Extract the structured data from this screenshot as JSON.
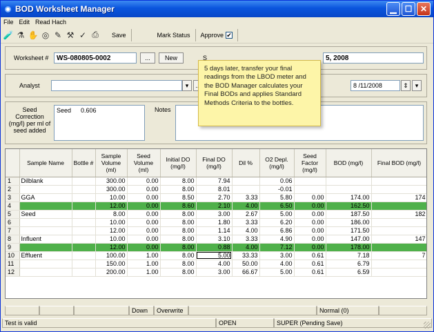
{
  "window": {
    "title": "BOD Worksheet Manager"
  },
  "menu": [
    "File",
    "Edit",
    "Read Hach"
  ],
  "toolbar": {
    "save": "Save",
    "mark_status": "Mark Status",
    "approve": "Approve",
    "approve_checked": "✔"
  },
  "header": {
    "worksheet_label": "Worksheet #",
    "worksheet_value": "WS-080805-0002",
    "browse_label": "...",
    "new_label": "New",
    "s_label": "S",
    "date_fragment": "5, 2008",
    "analyst_label": "Analyst",
    "analyst_value": "",
    "dots_label": "...",
    "date_value": "8 /11/2008"
  },
  "seed": {
    "correction_label": "Seed Correction (mg/l) per ml of seed added",
    "seed_name": "Seed",
    "seed_value": "0.606",
    "notes_label": "Notes"
  },
  "tooltip": "5 days later, transfer your final readings from the LBOD meter and the BOD Manager calculates your Final BODs and applies Standard Methods Criteria to the bottles.",
  "table": {
    "columns": [
      "",
      "Sample Name",
      "Bottle #",
      "Sample Volume (ml)",
      "Seed Volume (ml)",
      "Initial DO (mg/l)",
      "Final DO (mg/l)",
      "Dil %",
      "O2 Depl. (mg/l)",
      "Seed Factor (mg/l)",
      "BOD (mg/l)",
      "Final BOD (mg/l)"
    ],
    "rows": [
      [
        "1",
        "Dilblank",
        "",
        "300.00",
        "0.00",
        "8.00",
        "7.94",
        "",
        "0.06",
        "",
        "",
        ""
      ],
      [
        "2",
        "",
        "",
        "300.00",
        "0.00",
        "8.00",
        "8.01",
        "",
        "-0.01",
        "",
        "",
        ""
      ],
      [
        "3",
        "GGA",
        "",
        "10.00",
        "0.00",
        "8.50",
        "2.70",
        "3.33",
        "5.80",
        "0.00",
        "174.00",
        "174"
      ],
      [
        "4",
        "",
        "",
        "12.00",
        "0.00",
        "8.60",
        "2.10",
        "4.00",
        "6.50",
        "0.00",
        "162.50",
        ""
      ],
      [
        "5",
        "Seed",
        "",
        "8.00",
        "0.00",
        "8.00",
        "3.00",
        "2.67",
        "5.00",
        "0.00",
        "187.50",
        "182"
      ],
      [
        "6",
        "",
        "",
        "10.00",
        "0.00",
        "8.00",
        "1.80",
        "3.33",
        "6.20",
        "0.00",
        "186.00",
        ""
      ],
      [
        "7",
        "",
        "",
        "12.00",
        "0.00",
        "8.00",
        "1.14",
        "4.00",
        "6.86",
        "0.00",
        "171.50",
        ""
      ],
      [
        "8",
        "Influent",
        "",
        "10.00",
        "0.00",
        "8.00",
        "3.10",
        "3.33",
        "4.90",
        "0.00",
        "147.00",
        "147"
      ],
      [
        "9",
        "",
        "",
        "12.00",
        "0.00",
        "8.00",
        "0.88",
        "4.00",
        "7.12",
        "0.00",
        "178.00",
        ""
      ],
      [
        "10",
        "Effluent",
        "",
        "100.00",
        "1.00",
        "8.00",
        "5.00",
        "33.33",
        "3.00",
        "0.61",
        "7.18",
        "7"
      ],
      [
        "11",
        "",
        "",
        "150.00",
        "1.00",
        "8.00",
        "4.00",
        "50.00",
        "4.00",
        "0.61",
        "6.79",
        ""
      ],
      [
        "12",
        "",
        "",
        "200.00",
        "1.00",
        "8.00",
        "3.00",
        "66.67",
        "5.00",
        "0.61",
        "6.59",
        ""
      ]
    ],
    "highlight_rows": [
      3,
      8
    ],
    "highlight_color": "#4fb04a"
  },
  "status_bar": {
    "down": "Down",
    "overwrite": "Overwrite",
    "normal": "Normal (0)",
    "valid": "Test is valid",
    "open": "OPEN",
    "super": "SUPER (Pending Save)"
  }
}
